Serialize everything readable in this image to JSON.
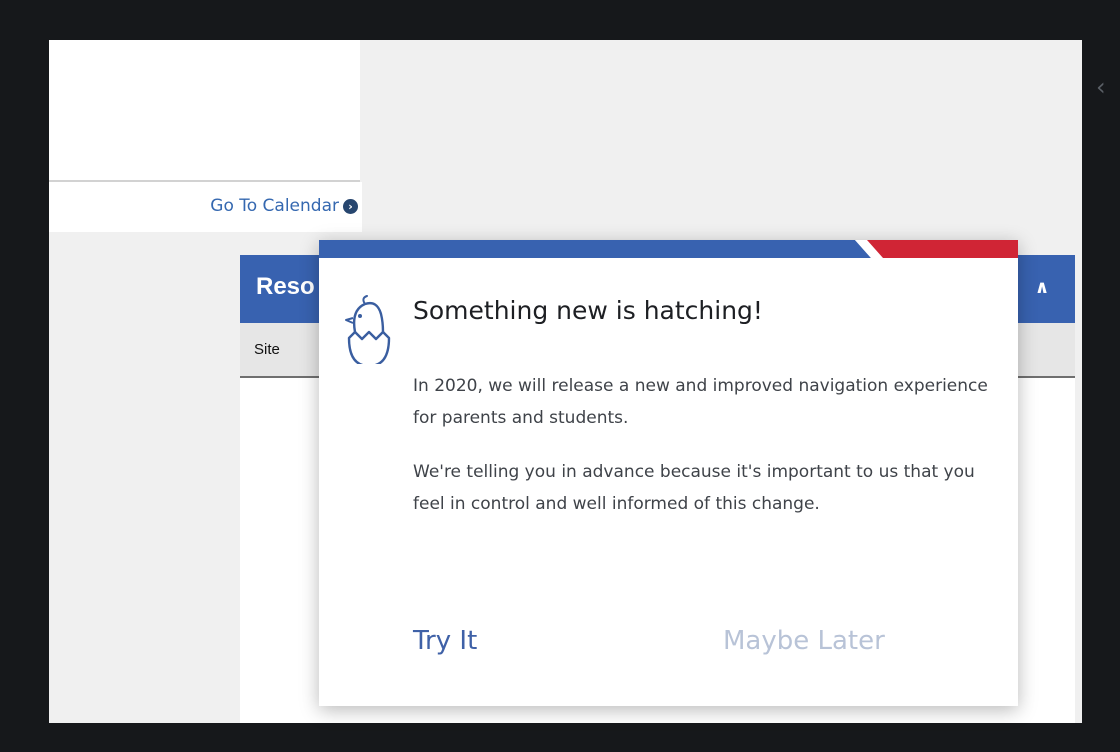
{
  "calendar": {
    "link_label": "Go To Calendar",
    "link_icon": "arrow-right-circle-icon"
  },
  "resources": {
    "title": "Reso",
    "column_site": "Site",
    "toggle_icon": "chevron-up-icon"
  },
  "side": {
    "collapse_icon": "chevron-left-icon"
  },
  "modal": {
    "icon": "hatching-chick-icon",
    "title": "Something new is hatching!",
    "paragraphs": [
      "In 2020, we will release a new and improved navigation experience for parents and students.",
      "We're telling you in advance because it's important to us that you feel in control and well informed of this change."
    ],
    "primary_action": "Try It",
    "secondary_action": "Maybe Later"
  },
  "colors": {
    "accent_blue": "#3862b0",
    "accent_red": "#d02535",
    "link_blue": "#3568b0",
    "muted_button": "#b8c3d7"
  }
}
